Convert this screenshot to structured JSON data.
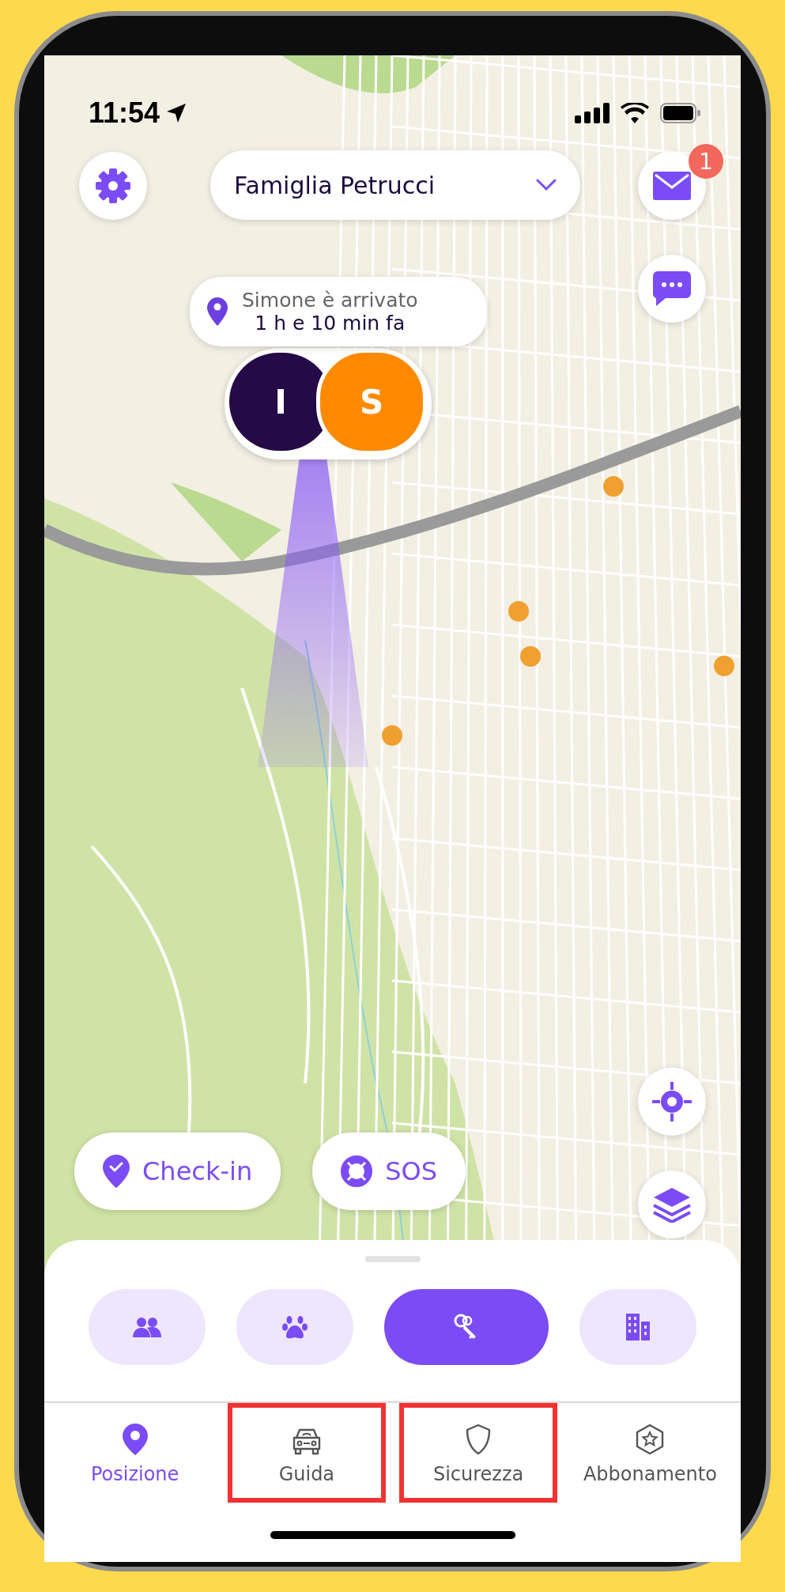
{
  "status_bar": {
    "time": "11:54"
  },
  "group_selector": {
    "label": "Famiglia Petrucci"
  },
  "messages": {
    "badge": "1"
  },
  "arrival_popup": {
    "title": "Simone è arrivato",
    "time": "1 h e 10 min fa"
  },
  "avatars": [
    {
      "initial": "I",
      "color": "#240a46"
    },
    {
      "initial": "S",
      "color": "#ff8a00"
    }
  ],
  "action_buttons": [
    {
      "kind": "checkin",
      "label": "Check-in"
    },
    {
      "kind": "sos",
      "label": "SOS"
    }
  ],
  "categories": [
    {
      "kind": "people",
      "selected": false
    },
    {
      "kind": "pets",
      "selected": false
    },
    {
      "kind": "keys",
      "selected": true
    },
    {
      "kind": "buildings",
      "selected": false
    }
  ],
  "tabs": [
    {
      "kind": "location",
      "label": "Posizione",
      "selected": true,
      "highlighted": false
    },
    {
      "kind": "car",
      "label": "Guida",
      "selected": false,
      "highlighted": true
    },
    {
      "kind": "shield",
      "label": "Sicurezza",
      "selected": false,
      "highlighted": true
    },
    {
      "kind": "subscription",
      "label": "Abbonamento",
      "selected": false,
      "highlighted": false
    }
  ]
}
